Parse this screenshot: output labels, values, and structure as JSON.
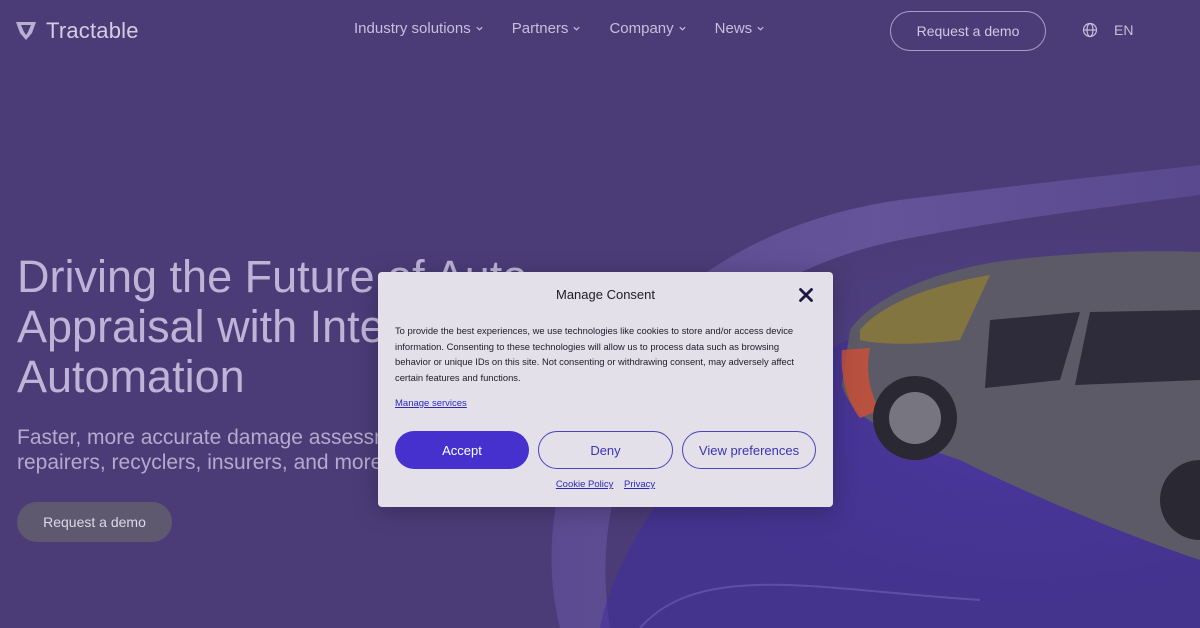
{
  "header": {
    "logo_text": "Tractable",
    "nav": [
      {
        "label": "Industry solutions"
      },
      {
        "label": "Partners"
      },
      {
        "label": "Company"
      },
      {
        "label": "News"
      }
    ],
    "demo_button": "Request a demo",
    "language": "EN"
  },
  "hero": {
    "title": "Driving the Future of Auto Appraisal with Intelligent Automation",
    "subtitle": "Faster, more accurate damage assessments for repairers, recyclers, insurers, and more",
    "demo_button": "Request a demo"
  },
  "consent": {
    "title": "Manage Consent",
    "body": "To provide the best experiences, we use technologies like cookies to store and/or access device information. Consenting to these technologies will allow us to process data such as browsing behavior or unique IDs on this site. Not consenting or withdrawing consent, may adversely affect certain features and functions.",
    "manage_services": "Manage services",
    "accept": "Accept",
    "deny": "Deny",
    "view_preferences": "View preferences",
    "cookie_policy": "Cookie Policy",
    "privacy": "Privacy"
  },
  "colors": {
    "background": "#4b3c78",
    "accent": "#4631cf",
    "modal_background": "#e3e0ea"
  },
  "icons": [
    "tractable-logo-icon",
    "chevron-down-icon",
    "globe-icon",
    "close-icon"
  ]
}
